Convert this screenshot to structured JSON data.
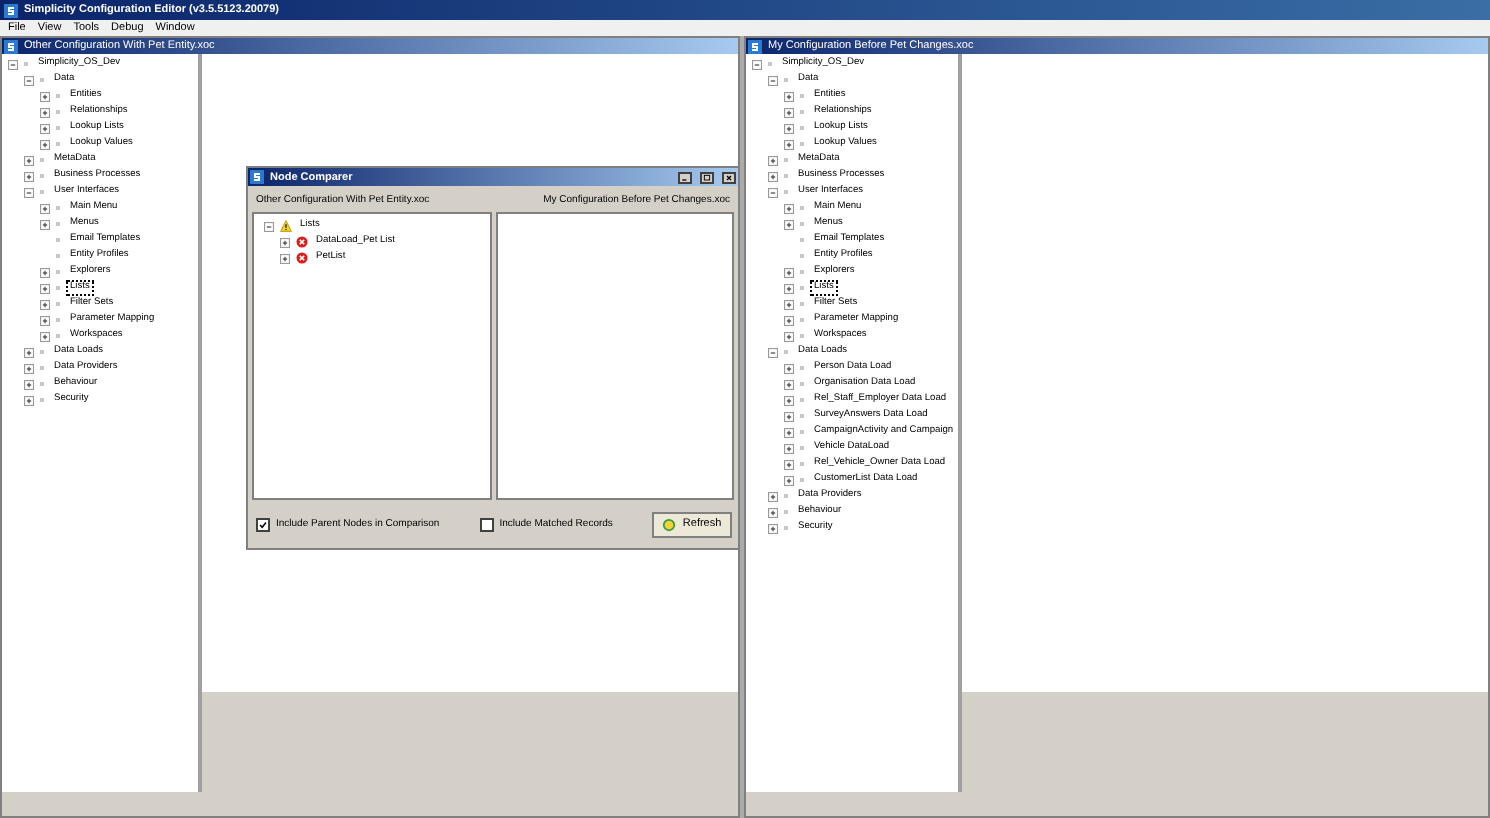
{
  "app": {
    "title": "Simplicity Configuration Editor (v3.5.5123.20079)",
    "menu": [
      "File",
      "View",
      "Tools",
      "Debug",
      "Window"
    ]
  },
  "windows": [
    {
      "title": "Other Configuration With Pet Entity.xoc",
      "tree": [
        {
          "label": "Simplicity_OS_Dev",
          "expanded": true,
          "selected": false,
          "children": [
            {
              "label": "Data",
              "expanded": true,
              "selected": false,
              "children": [
                {
                  "label": "Entities",
                  "expanded": false,
                  "selected": false
                },
                {
                  "label": "Relationships",
                  "expanded": false,
                  "selected": false
                },
                {
                  "label": "Lookup Lists",
                  "expanded": false,
                  "selected": false
                },
                {
                  "label": "Lookup Values",
                  "expanded": false,
                  "selected": false
                }
              ]
            },
            {
              "label": "MetaData",
              "expanded": false,
              "selected": false
            },
            {
              "label": "Business Processes",
              "expanded": false,
              "selected": false
            },
            {
              "label": "User Interfaces",
              "expanded": true,
              "selected": false,
              "children": [
                {
                  "label": "Main Menu",
                  "expanded": false,
                  "selected": false
                },
                {
                  "label": "Menus",
                  "expanded": false,
                  "selected": false
                },
                {
                  "label": "Email Templates",
                  "selected": false
                },
                {
                  "label": "Entity Profiles",
                  "selected": false
                },
                {
                  "label": "Explorers",
                  "expanded": false,
                  "selected": false
                },
                {
                  "label": "Lists",
                  "expanded": false,
                  "selected": true
                },
                {
                  "label": "Filter Sets",
                  "expanded": false,
                  "selected": false
                },
                {
                  "label": "Parameter Mapping",
                  "expanded": false,
                  "selected": false
                },
                {
                  "label": "Workspaces",
                  "expanded": false,
                  "selected": false
                }
              ]
            },
            {
              "label": "Data Loads",
              "expanded": false,
              "selected": false
            },
            {
              "label": "Data Providers",
              "expanded": false,
              "selected": false
            },
            {
              "label": "Behaviour",
              "expanded": false,
              "selected": false
            },
            {
              "label": "Security",
              "expanded": false,
              "selected": false
            }
          ]
        }
      ]
    },
    {
      "title": "My Configuration Before Pet Changes.xoc",
      "tree": [
        {
          "label": "Simplicity_OS_Dev",
          "expanded": true,
          "selected": false,
          "children": [
            {
              "label": "Data",
              "expanded": true,
              "selected": false,
              "children": [
                {
                  "label": "Entities",
                  "expanded": false,
                  "selected": false
                },
                {
                  "label": "Relationships",
                  "expanded": false,
                  "selected": false
                },
                {
                  "label": "Lookup Lists",
                  "expanded": false,
                  "selected": false
                },
                {
                  "label": "Lookup Values",
                  "expanded": false,
                  "selected": false
                }
              ]
            },
            {
              "label": "MetaData",
              "expanded": false,
              "selected": false
            },
            {
              "label": "Business Processes",
              "expanded": false,
              "selected": false
            },
            {
              "label": "User Interfaces",
              "expanded": true,
              "selected": false,
              "children": [
                {
                  "label": "Main Menu",
                  "expanded": false,
                  "selected": false
                },
                {
                  "label": "Menus",
                  "expanded": false,
                  "selected": false
                },
                {
                  "label": "Email Templates",
                  "selected": false
                },
                {
                  "label": "Entity Profiles",
                  "selected": false
                },
                {
                  "label": "Explorers",
                  "expanded": false,
                  "selected": false
                },
                {
                  "label": "Lists",
                  "expanded": false,
                  "selected": true
                },
                {
                  "label": "Filter Sets",
                  "expanded": false,
                  "selected": false
                },
                {
                  "label": "Parameter Mapping",
                  "expanded": false,
                  "selected": false
                },
                {
                  "label": "Workspaces",
                  "expanded": false,
                  "selected": false
                }
              ]
            },
            {
              "label": "Data Loads",
              "expanded": true,
              "selected": false,
              "children": [
                {
                  "label": "Person Data Load",
                  "expanded": false,
                  "selected": false
                },
                {
                  "label": "Organisation Data Load",
                  "expanded": false,
                  "selected": false
                },
                {
                  "label": "Rel_Staff_Employer Data Load",
                  "expanded": false,
                  "selected": false
                },
                {
                  "label": "SurveyAnswers Data Load",
                  "expanded": false,
                  "selected": false
                },
                {
                  "label": "CampaignActivity and Campaign",
                  "expanded": false,
                  "selected": false
                },
                {
                  "label": "Vehicle DataLoad",
                  "expanded": false,
                  "selected": false
                },
                {
                  "label": "Rel_Vehicle_Owner Data Load",
                  "expanded": false,
                  "selected": false
                },
                {
                  "label": "CustomerList Data Load",
                  "expanded": false,
                  "selected": false
                }
              ]
            },
            {
              "label": "Data Providers",
              "expanded": false,
              "selected": false
            },
            {
              "label": "Behaviour",
              "expanded": false,
              "selected": false
            },
            {
              "label": "Security",
              "expanded": false,
              "selected": false
            }
          ]
        }
      ]
    }
  ],
  "dialog": {
    "title": "Node Comparer",
    "left_header": "Other Configuration With Pet Entity.xoc",
    "right_header": "My Configuration Before Pet Changes.xoc",
    "tree": [
      {
        "label": "Lists",
        "kind": "warning",
        "expanded": true,
        "selected": false,
        "children": [
          {
            "label": "DataLoad_Pet List",
            "kind": "error",
            "expanded": false,
            "selected": false
          },
          {
            "label": "PetList",
            "kind": "error",
            "expanded": false,
            "selected": false
          }
        ]
      }
    ],
    "options": [
      {
        "label": "Include Parent Nodes in Comparison",
        "checked": true
      },
      {
        "label": "Include Matched Records",
        "checked": false
      }
    ],
    "button": "Refresh"
  }
}
